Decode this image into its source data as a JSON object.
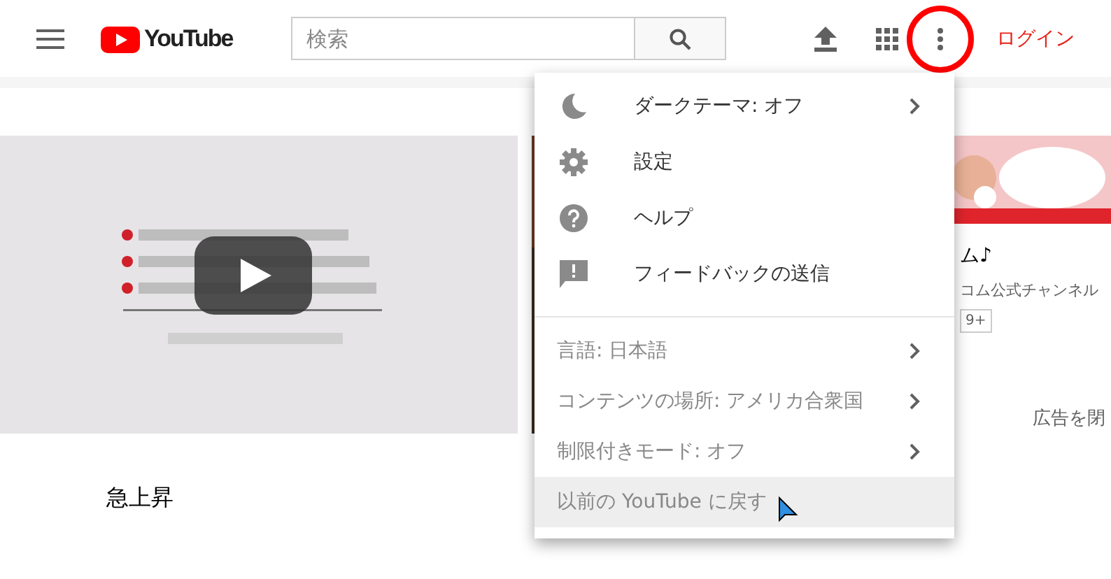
{
  "header": {
    "logo": "YouTube",
    "search": {
      "placeholder": "検索"
    },
    "login": "ログイン",
    "highlight_more": true
  },
  "ad_banner": {
    "title": "ム♪",
    "channel": "コム公式チャンネル",
    "badge": "9+",
    "close": "広告を閉"
  },
  "section_title": "急上昇",
  "menu": {
    "groups": [
      {
        "items": [
          {
            "kind": "icon",
            "label": "ダークテーマ: オフ",
            "submenu": true,
            "highlighted": false
          },
          {
            "kind": "icon",
            "label": "設定",
            "submenu": false,
            "highlighted": false
          },
          {
            "kind": "icon",
            "label": "ヘルプ",
            "submenu": false,
            "highlighted": false
          },
          {
            "kind": "icon",
            "label": "フィードバックの送信",
            "submenu": false,
            "highlighted": false
          }
        ]
      },
      {
        "items": [
          {
            "kind": "plain",
            "label": "言語: 日本語",
            "submenu": true,
            "highlighted": false
          },
          {
            "kind": "plain",
            "label": "コンテンツの場所: アメリカ合衆国",
            "submenu": true,
            "highlighted": false
          },
          {
            "kind": "plain",
            "label": "制限付きモード: オフ",
            "submenu": true,
            "highlighted": false
          },
          {
            "kind": "plain",
            "label": "以前の YouTube に戻す",
            "submenu": false,
            "highlighted": true
          }
        ]
      }
    ]
  }
}
